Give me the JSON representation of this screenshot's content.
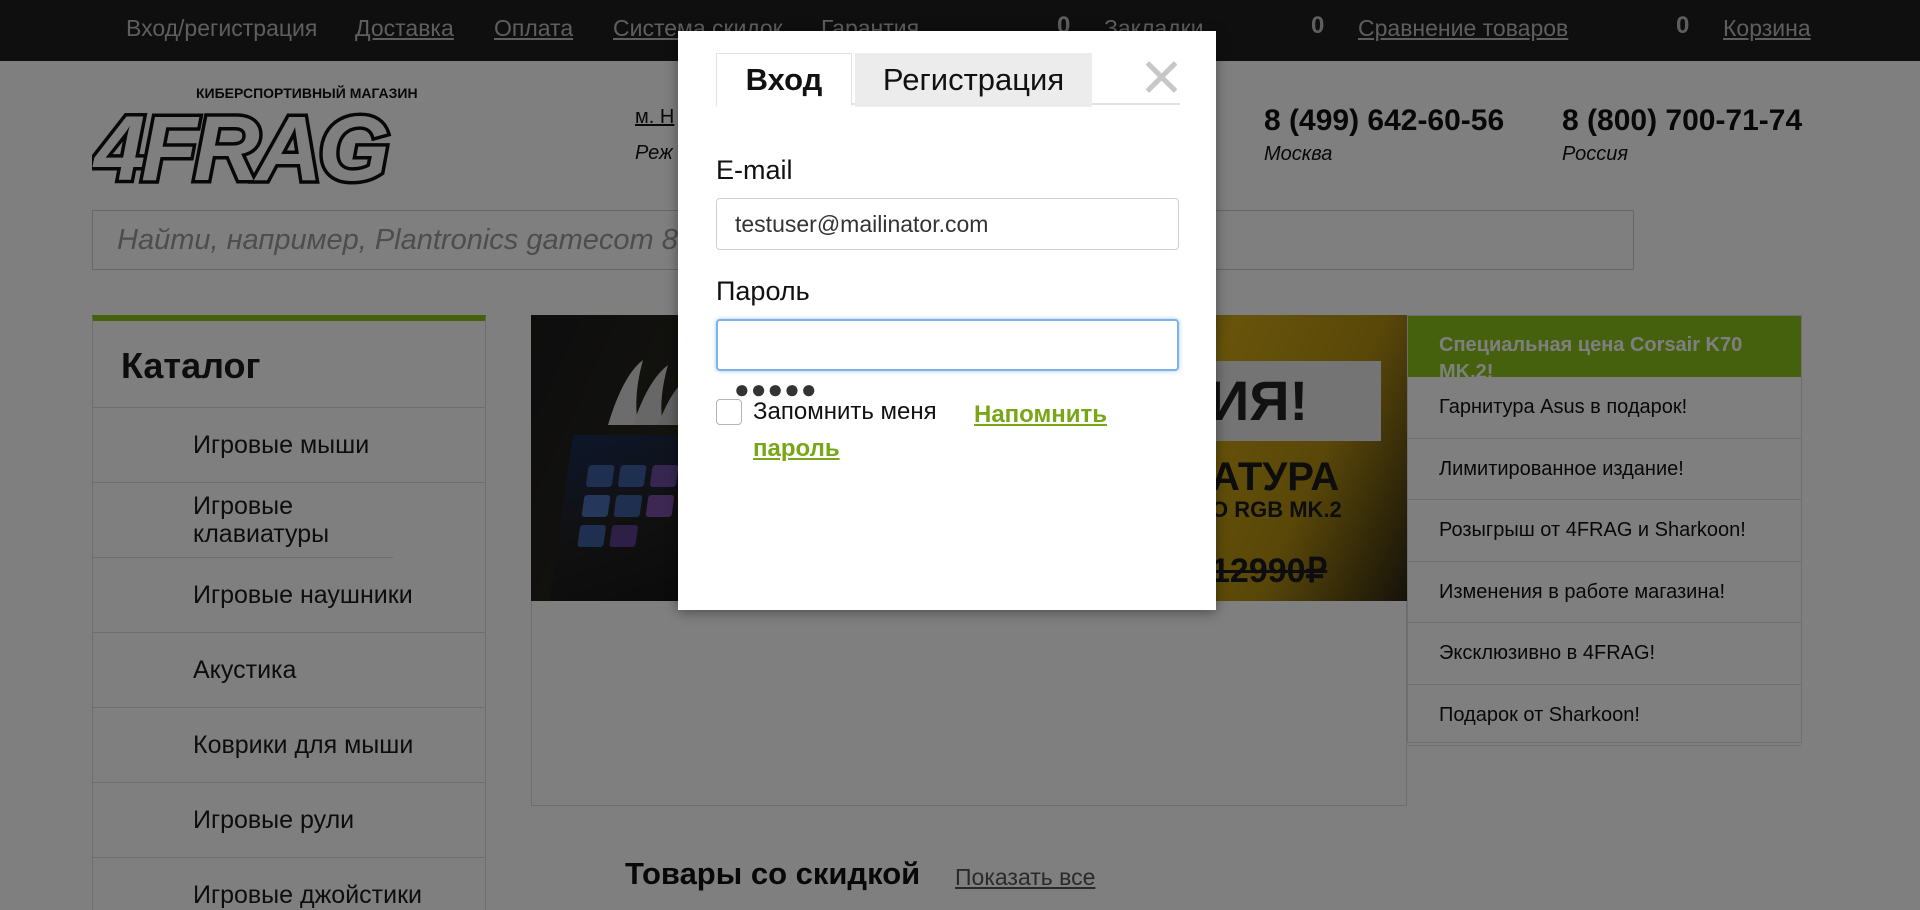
{
  "top_bar": {
    "links": [
      "Вход/регистрация",
      "Доставка",
      "Оплата",
      "Система скидок",
      "Гарантия"
    ],
    "bookmarks": {
      "count": "0",
      "label": "Закладки"
    },
    "compare": {
      "count": "0",
      "label": "Сравнение товаров"
    },
    "cart": {
      "count": "0",
      "label": "Корзина"
    }
  },
  "header": {
    "logo_text": "4FRAG",
    "logo_tagline": "КИБЕРСПОРТИВНЫЙ МАГАЗИН",
    "metro": "м. Н",
    "hours": "Реж",
    "phones": [
      {
        "number": "8 (499) 642-60-56",
        "city": "Москва"
      },
      {
        "number": "8 (800) 700-71-74",
        "city": "Россия"
      }
    ]
  },
  "search": {
    "placeholder": "Найти, например, Plantronics gamecom 818"
  },
  "catalog": {
    "title": "Каталог",
    "items": [
      "Игровые мыши",
      "Игровые клавиатуры",
      "Игровые наушники",
      "Акустика",
      "Коврики для мыши",
      "Игровые рули",
      "Игровые джойстики"
    ]
  },
  "banner": {
    "sale_text": "ИЯ!",
    "product_line1": "АТУРА",
    "product_line2": "O RGB MK.2",
    "old_price": "12990₽"
  },
  "news": {
    "header": "Специальная цена Corsair K70 MK.2!",
    "items": [
      "Гарнитура Asus в подарок!",
      "Лимитированное издание!",
      "Розыгрыш от 4FRAG и Sharkoon!",
      "Изменения в работе магазина!",
      "Эксклюзивно в 4FRAG!",
      "Подарок от Sharkoon!"
    ]
  },
  "discount_section": {
    "title": "Товары со скидкой",
    "show_all": "Показать все"
  },
  "modal": {
    "tabs": {
      "login": "Вход",
      "register": "Регистрация"
    },
    "email_label": "E-mail",
    "email_value": "testuser@mailinator.com",
    "password_label": "Пароль",
    "password_mask": "●●●●●",
    "remember_label": "Запомнить меня",
    "forgot_link": "Напомнить пароль",
    "accent_color": "#79a616"
  }
}
